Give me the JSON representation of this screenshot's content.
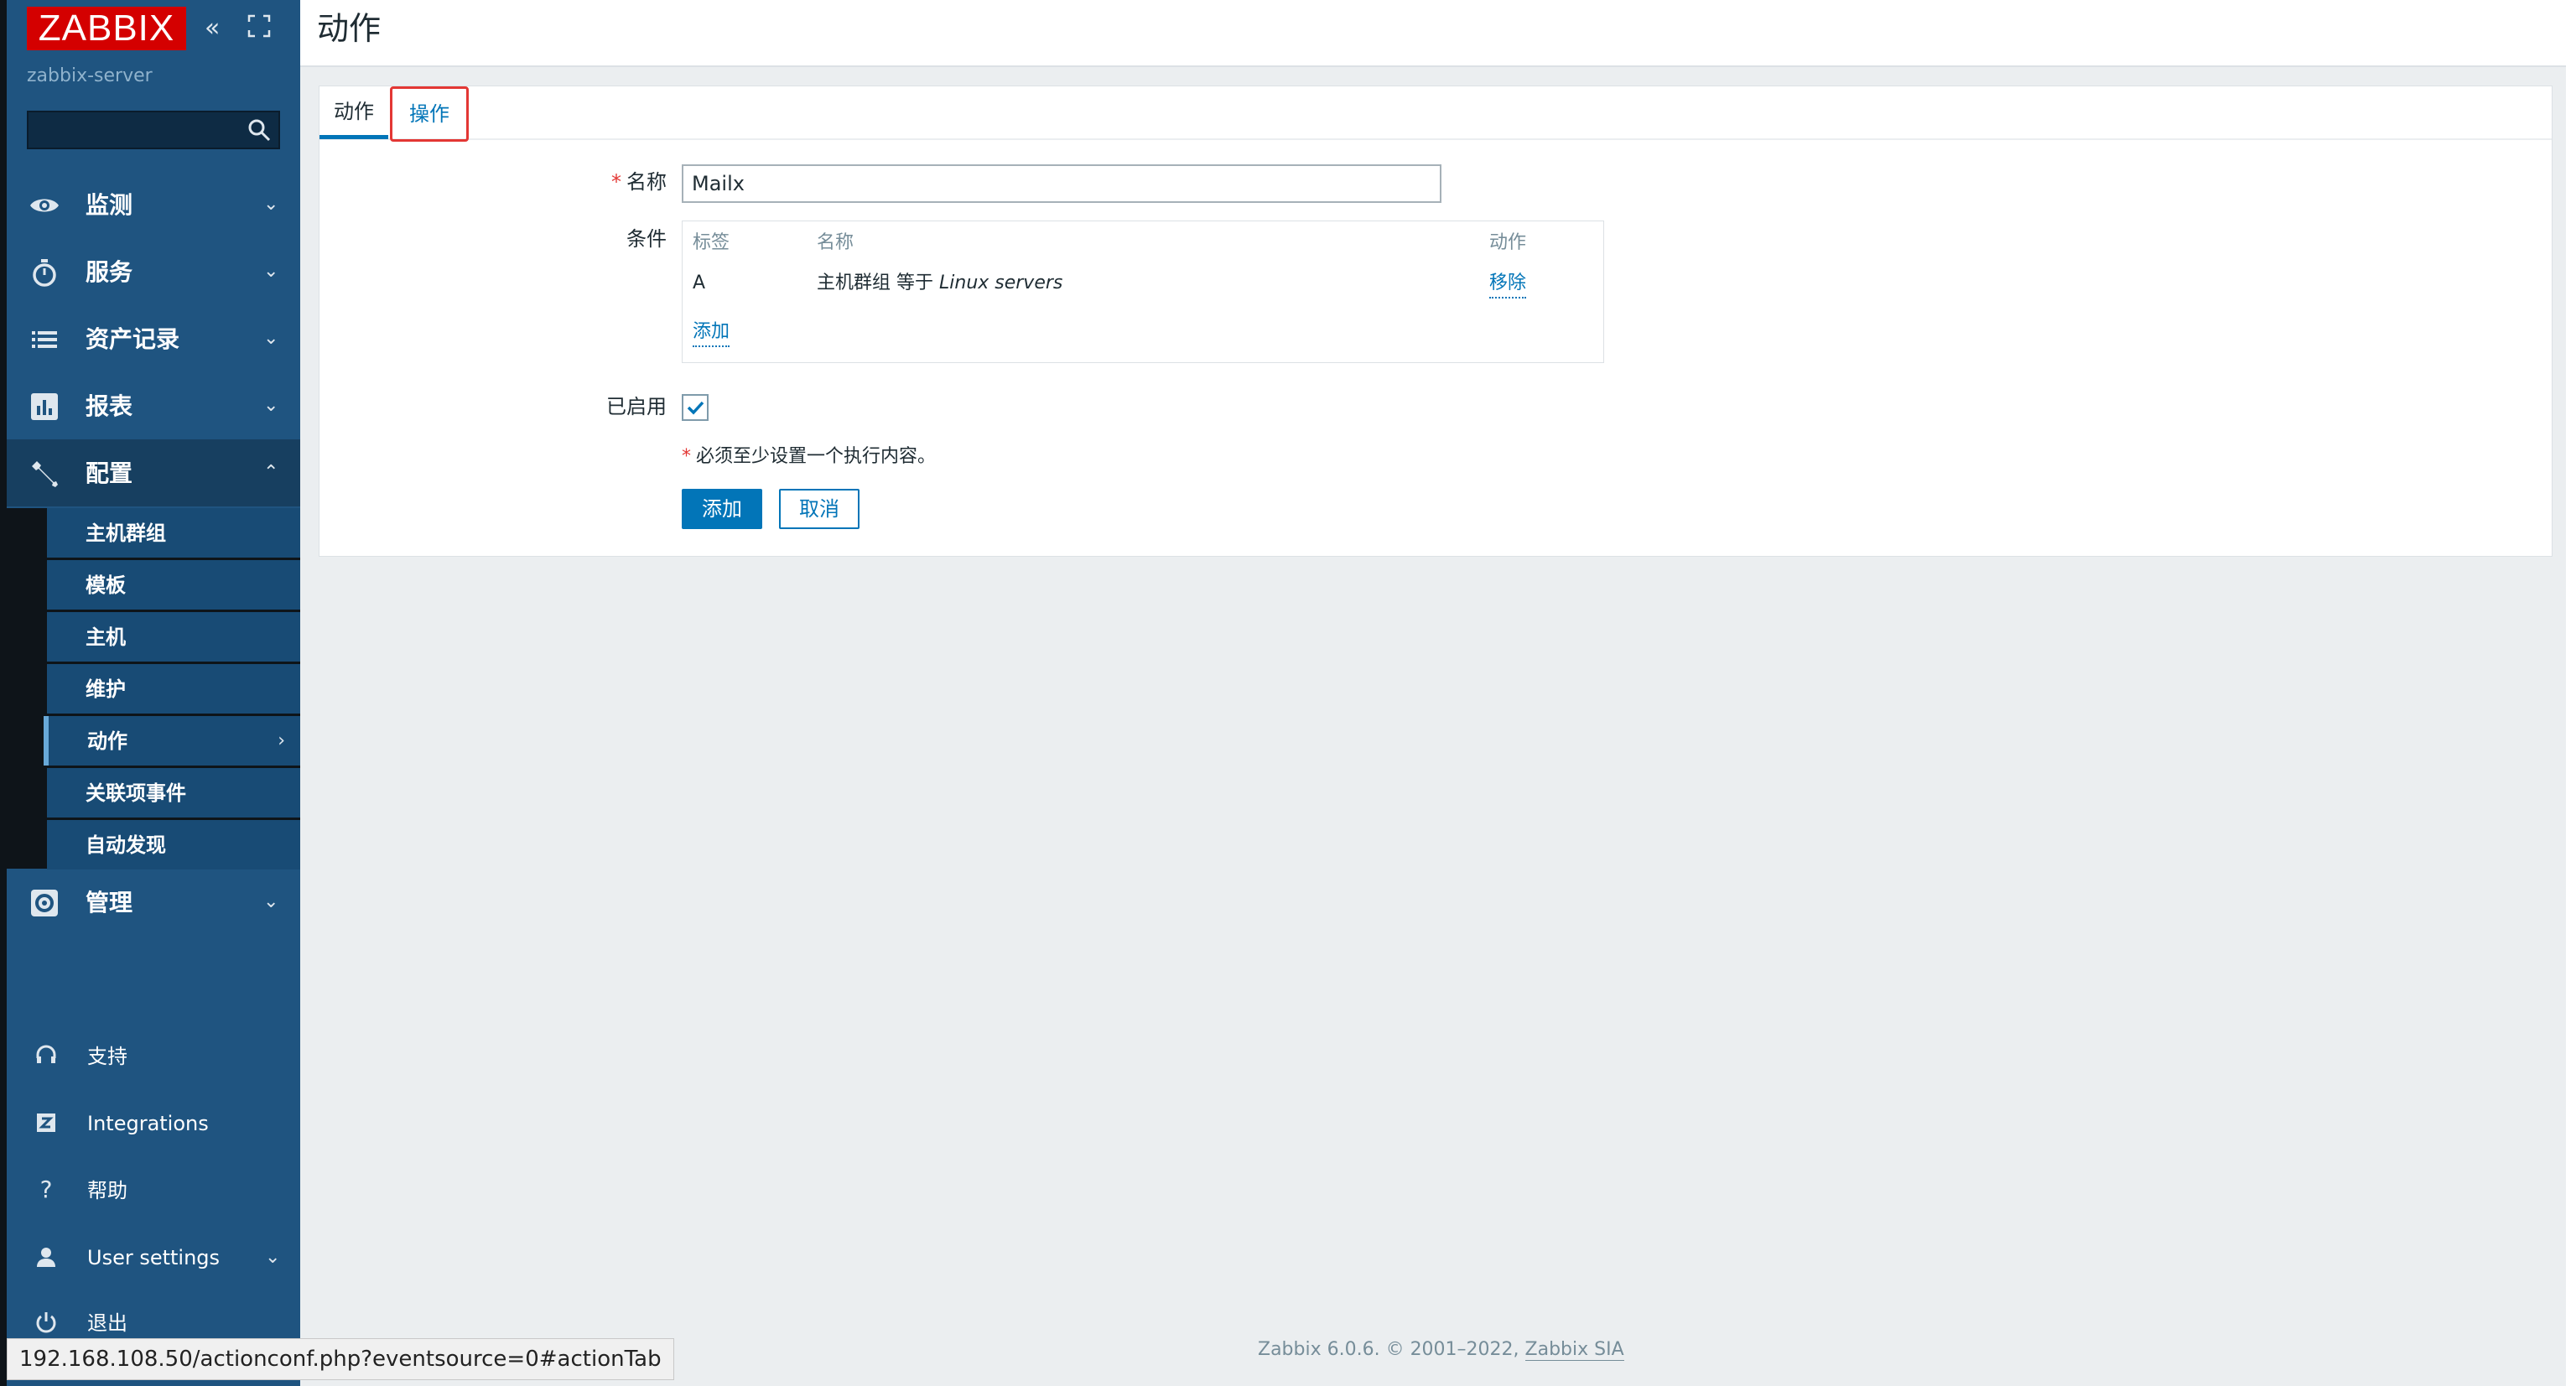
{
  "app": {
    "logo_text": "ZABBIX",
    "server_name": "zabbix-server",
    "search": {
      "value": "",
      "placeholder": ""
    },
    "colors": {
      "sidebar": "#1f5480",
      "accent": "#0275b8",
      "logo": "#d40000",
      "required": "#e33734"
    }
  },
  "sidebar": {
    "main": [
      {
        "label": "监测",
        "icon": "eye-icon"
      },
      {
        "label": "服务",
        "icon": "stopwatch-icon"
      },
      {
        "label": "资产记录",
        "icon": "list-icon"
      },
      {
        "label": "报表",
        "icon": "bar-chart-icon"
      },
      {
        "label": "配置",
        "icon": "wrench-icon"
      },
      {
        "label": "管理",
        "icon": "gear-icon"
      }
    ],
    "config_submenu": [
      "主机群组",
      "模板",
      "主机",
      "维护",
      "动作",
      "关联项事件",
      "自动发现"
    ],
    "footer": [
      {
        "label": "支持",
        "icon": "headset-icon"
      },
      {
        "label": "Integrations",
        "icon": "zabbix-z-icon"
      },
      {
        "label": "帮助",
        "icon": "question-icon"
      },
      {
        "label": "User settings",
        "icon": "user-icon"
      },
      {
        "label": "退出",
        "icon": "power-icon"
      }
    ]
  },
  "header": {
    "title": "动作"
  },
  "tabs": {
    "actions": "动作",
    "operations": "操作"
  },
  "form": {
    "name_label": "名称",
    "name_value": "Mailx",
    "conditions_label": "条件",
    "cond_headers": {
      "tag": "标签",
      "name": "名称",
      "action": "动作"
    },
    "cond_rows": [
      {
        "tag": "A",
        "name_prefix": "主机群组 等于 ",
        "name_value": "Linux servers",
        "action": "移除"
      }
    ],
    "cond_add": "添加",
    "enabled_label": "已启用",
    "enabled": true,
    "hint": "必须至少设置一个执行内容。",
    "add_button": "添加",
    "cancel_button": "取消"
  },
  "footer": {
    "text": "Zabbix 6.0.6. © 2001–2022, ",
    "link": "Zabbix SIA"
  },
  "status_bar": {
    "url": "192.168.108.50/actionconf.php?eventsource=0#actionTab"
  }
}
